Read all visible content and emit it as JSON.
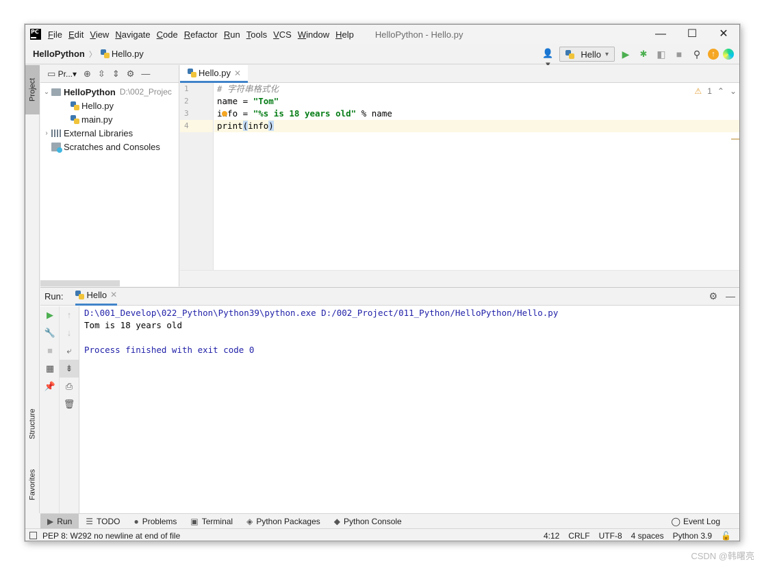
{
  "window": {
    "title": "HelloPython - Hello.py",
    "menu": [
      "File",
      "Edit",
      "View",
      "Navigate",
      "Code",
      "Refactor",
      "Run",
      "Tools",
      "VCS",
      "Window",
      "Help"
    ],
    "logo": "PC",
    "controls": {
      "minimize": "—",
      "maximize": "☐",
      "close": "✕"
    }
  },
  "navbar": {
    "project": "HelloPython",
    "file": "Hello.py",
    "run_config": "Hello"
  },
  "left_stripe": {
    "project": "Project",
    "structure": "Structure",
    "favorites": "Favorites"
  },
  "project_panel": {
    "toolbar_label": "Pr...",
    "tree": [
      {
        "label": "HelloPython",
        "path": "D:\\002_Projec",
        "type": "folder",
        "expanded": true
      },
      {
        "label": "Hello.py",
        "type": "python-file"
      },
      {
        "label": "main.py",
        "type": "python-file"
      },
      {
        "label": "External Libraries",
        "type": "library"
      },
      {
        "label": "Scratches and Consoles",
        "type": "scratch"
      }
    ]
  },
  "editor": {
    "tab": "Hello.py",
    "warnings": "1",
    "line_numbers": [
      "1",
      "2",
      "3",
      "4"
    ],
    "lines": [
      {
        "parts": [
          {
            "t": "# 字符串格式化",
            "c": "cm"
          }
        ]
      },
      {
        "parts": [
          {
            "t": "name = ",
            "c": ""
          },
          {
            "t": "\"Tom\"",
            "c": "str"
          }
        ]
      },
      {
        "parts": [
          {
            "t": "info = ",
            "c": ""
          },
          {
            "t": "\"%s is 18 years old\"",
            "c": "str"
          },
          {
            "t": " % name",
            "c": ""
          }
        ]
      },
      {
        "parts": [
          {
            "t": "print",
            "c": ""
          },
          {
            "t": "(",
            "c": "hl"
          },
          {
            "t": "info",
            "c": ""
          },
          {
            "t": ")",
            "c": "hl"
          }
        ]
      }
    ]
  },
  "run_panel": {
    "label": "Run:",
    "tab": "Hello",
    "output": [
      {
        "text": "D:\\001_Develop\\022_Python\\Python39\\python.exe D:/002_Project/011_Python/HelloPython/Hello.py",
        "color": "blue"
      },
      {
        "text": "Tom is 18 years old",
        "color": "black"
      },
      {
        "text": "",
        "color": "black"
      },
      {
        "text": "Process finished with exit code 0",
        "color": "blue"
      }
    ]
  },
  "bottom_tools": [
    {
      "label": "Run",
      "icon": "▶",
      "active": true
    },
    {
      "label": "TODO",
      "icon": "☰",
      "active": false
    },
    {
      "label": "Problems",
      "icon": "●",
      "active": false
    },
    {
      "label": "Terminal",
      "icon": "▣",
      "active": false
    },
    {
      "label": "Python Packages",
      "icon": "◈",
      "active": false
    },
    {
      "label": "Python Console",
      "icon": "◆",
      "active": false
    }
  ],
  "event_log": "Event Log",
  "status": {
    "message": "PEP 8: W292 no newline at end of file",
    "position": "4:12",
    "line_sep": "CRLF",
    "encoding": "UTF-8",
    "indent": "4 spaces",
    "interpreter": "Python 3.9"
  },
  "watermark": "CSDN @韩曙亮"
}
